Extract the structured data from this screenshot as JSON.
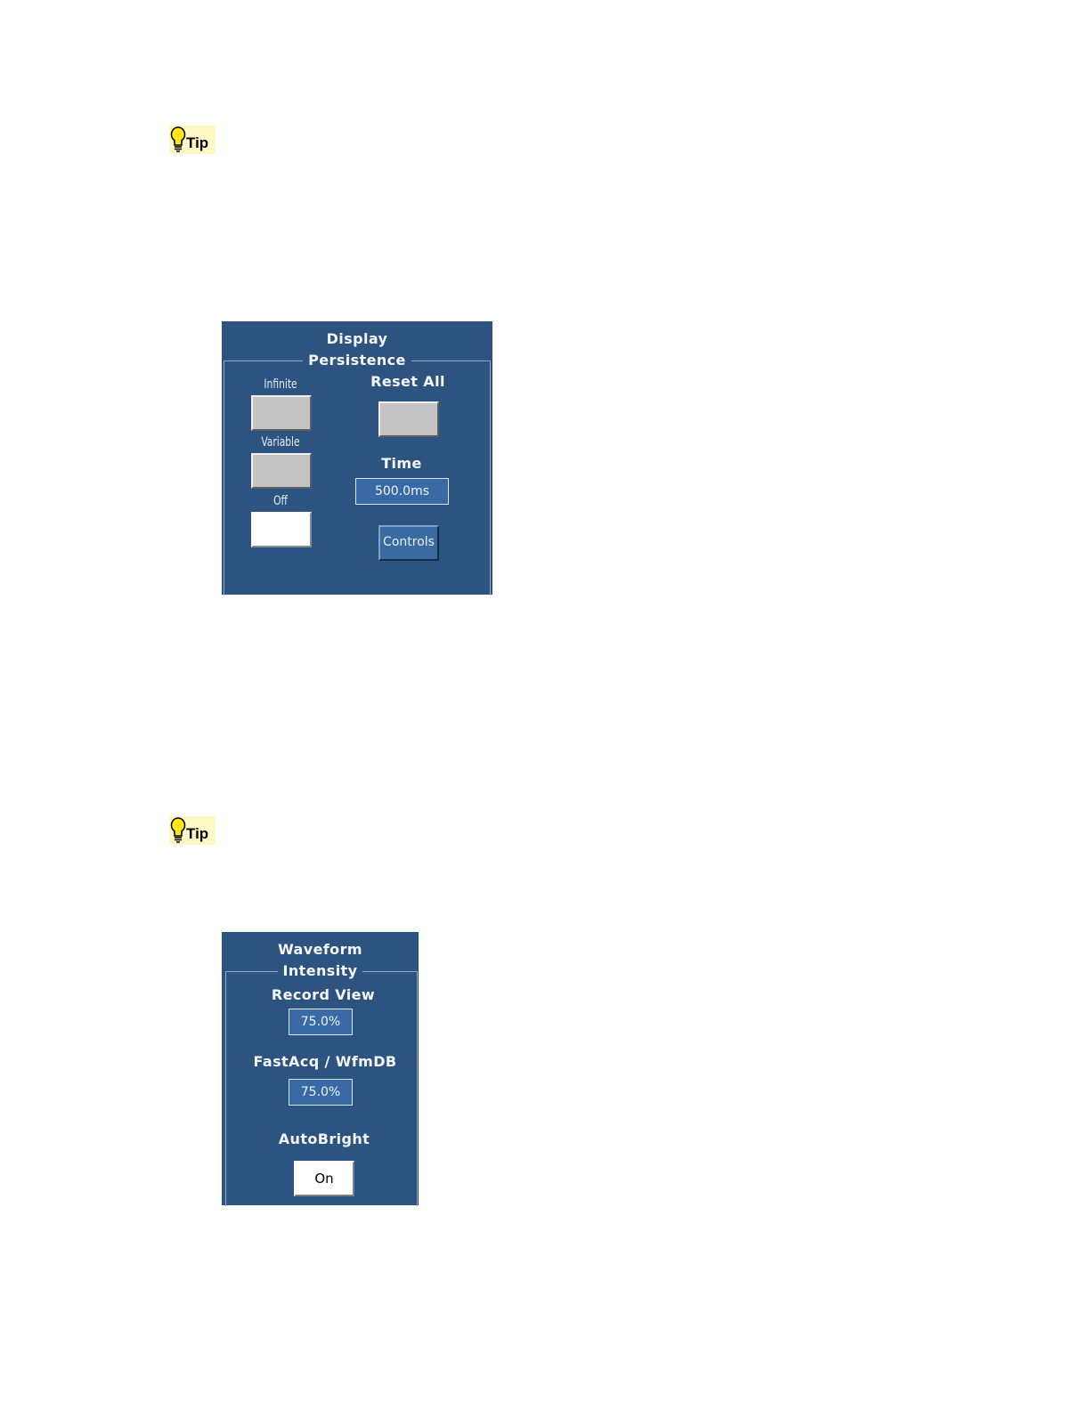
{
  "tips": [
    {
      "label": "Tip"
    },
    {
      "label": "Tip"
    }
  ],
  "display_persistence": {
    "title_line1": "Display",
    "title_line2": "Persistence",
    "infinite_label": "Infinite",
    "variable_label": "Variable",
    "off_label": "Off",
    "reset_all_label": "Reset All",
    "time_label": "Time",
    "time_value": "500.0ms",
    "controls_label": "Controls",
    "selected_mode": "Off"
  },
  "waveform_intensity": {
    "title_line1": "Waveform",
    "title_line2": "Intensity",
    "record_view_label": "Record View",
    "record_view_value": "75.0%",
    "fastacq_label": "FastAcq / WfmDB",
    "fastacq_value": "75.0%",
    "autobright_label": "AutoBright",
    "autobright_value": "On"
  },
  "colors": {
    "panel_bg": "#2d5481",
    "field_bg": "#3a6aa5",
    "tip_bg": "#fff8c4"
  }
}
